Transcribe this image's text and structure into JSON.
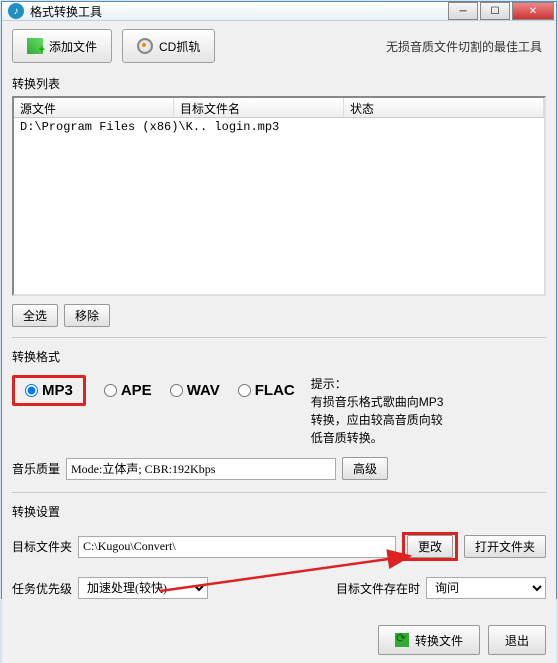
{
  "titlebar": {
    "title": "格式转换工具"
  },
  "toolbar": {
    "add_file": "添加文件",
    "cd_grab": "CD抓轨",
    "slogan": "无损音质文件切割的最佳工具"
  },
  "list": {
    "label": "转换列表",
    "cols": {
      "source": "源文件",
      "target": "目标文件名",
      "status": "状态"
    },
    "rows": [
      {
        "source": "D:\\Program Files (x86)\\K.. login.mp3",
        "target": "",
        "status": ""
      }
    ],
    "select_all": "全选",
    "remove": "移除"
  },
  "format": {
    "label": "转换格式",
    "options": {
      "mp3": "MP3",
      "ape": "APE",
      "wav": "WAV",
      "flac": "FLAC"
    },
    "selected": "mp3",
    "hint_title": "提示：",
    "hint_body": "有损音乐格式歌曲向MP3转换，应由较高音质向较低音质转换。",
    "quality_label": "音乐质量",
    "quality_value": "Mode:立体声; CBR:192Kbps",
    "advanced": "高级"
  },
  "settings": {
    "label": "转换设置",
    "target_dir_label": "目标文件夹",
    "target_dir": "C:\\Kugou\\Convert\\",
    "change": "更改",
    "open_folder": "打开文件夹",
    "priority_label": "任务优先级",
    "priority_value": "加速处理(较快)",
    "exist_label": "目标文件存在时",
    "exist_value": "询问"
  },
  "footer": {
    "convert": "转换文件",
    "exit": "退出"
  }
}
